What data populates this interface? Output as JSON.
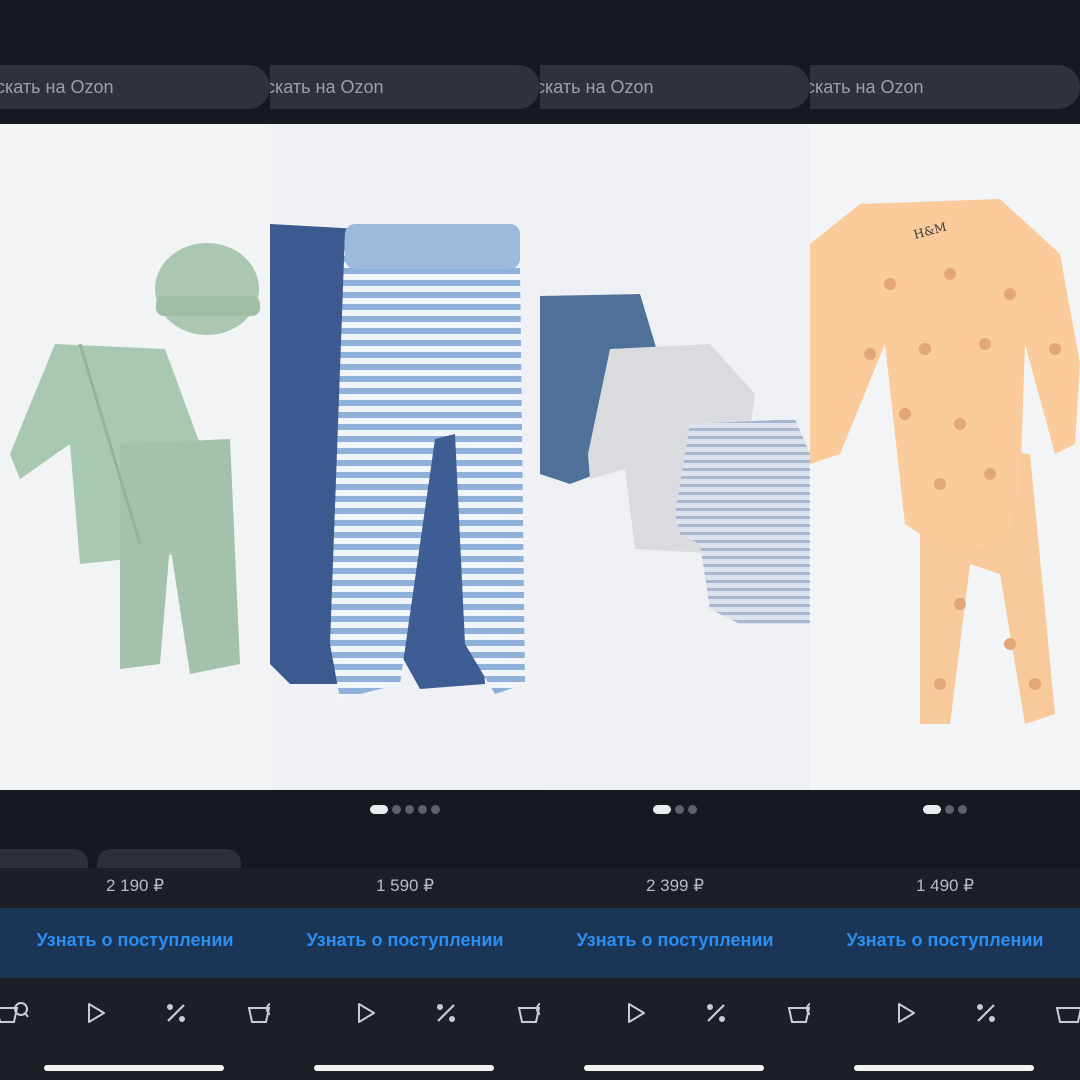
{
  "search_placeholder": "скать на Ozon",
  "cta_label": "Узнать о поступлении",
  "panels": [
    {
      "price": "2 190 ₽",
      "dots_total": 0,
      "dot_active": 0
    },
    {
      "price": "1 590 ₽",
      "dots_total": 5,
      "dot_active": 1
    },
    {
      "price": "2 399 ₽",
      "dots_total": 3,
      "dot_active": 1
    },
    {
      "price": "1 490 ₽",
      "dots_total": 3,
      "dot_active": 1
    }
  ],
  "photo_brand_label": "H&M",
  "nav_icons": [
    "basket-search-icon",
    "play-icon",
    "percent-icon"
  ],
  "colors": {
    "cta_text": "#2b8ff2",
    "cta_bg": "#1b3556",
    "bg": "#1c1f26"
  }
}
